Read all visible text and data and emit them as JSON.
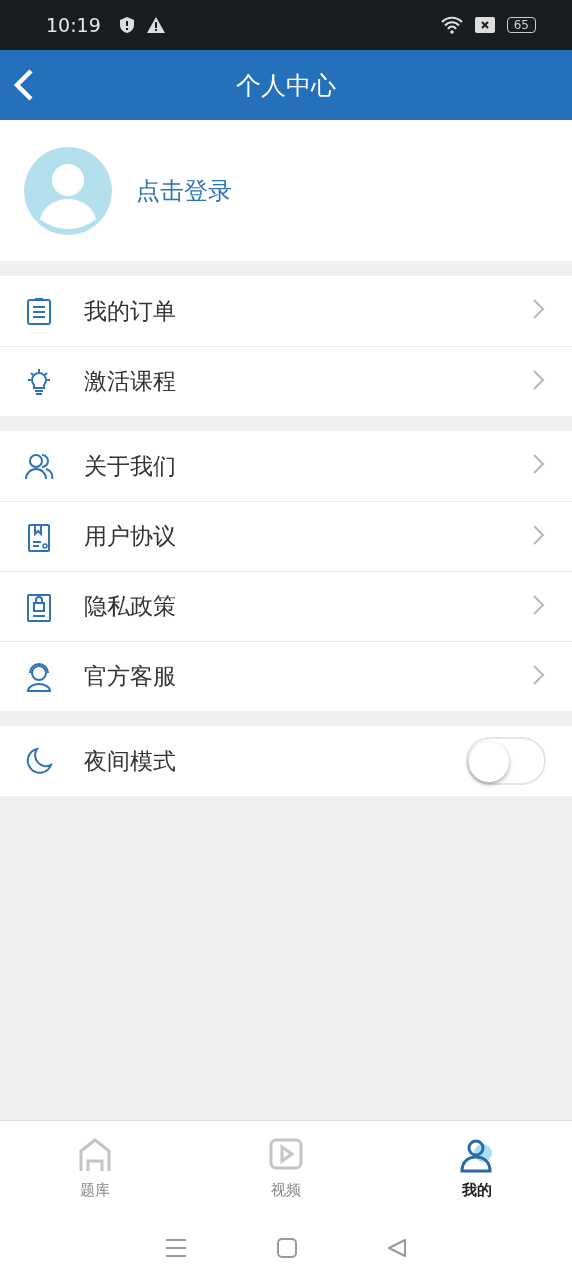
{
  "status_bar": {
    "time": "10:19",
    "battery": "65"
  },
  "header": {
    "title": "个人中心"
  },
  "profile": {
    "login": "点击登录"
  },
  "groups": [
    {
      "items": [
        {
          "label": "我的订单",
          "kind": "link"
        },
        {
          "label": "激活课程",
          "kind": "link"
        }
      ]
    },
    {
      "items": [
        {
          "label": "关于我们",
          "kind": "link"
        },
        {
          "label": "用户协议",
          "kind": "link"
        },
        {
          "label": "隐私政策",
          "kind": "link"
        },
        {
          "label": "官方客服",
          "kind": "link"
        }
      ]
    },
    {
      "items": [
        {
          "label": "夜间模式",
          "kind": "toggle",
          "on": false
        }
      ]
    }
  ],
  "tabs": [
    {
      "label": "题库",
      "selected": false
    },
    {
      "label": "视频",
      "selected": false
    },
    {
      "label": "我的",
      "selected": true
    }
  ]
}
